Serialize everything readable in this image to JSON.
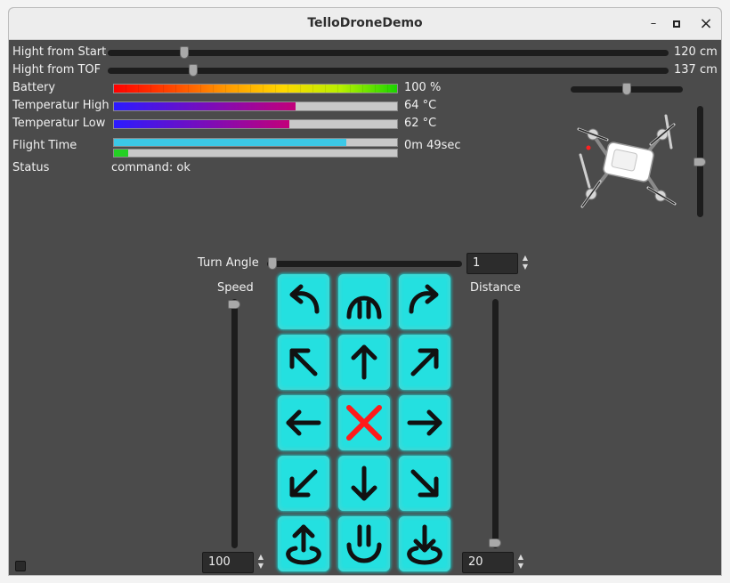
{
  "window": {
    "title": "TelloDroneDemo",
    "minimize": "–",
    "maximize": "▫",
    "close": "×"
  },
  "telemetry": {
    "height_start": {
      "label": "Hight from Start",
      "value": "120 cm",
      "level": 0.13
    },
    "height_tof": {
      "label": "Hight from TOF",
      "value": "137 cm",
      "level": 0.145
    },
    "battery": {
      "label": "Battery",
      "value": "100 %",
      "percent": 100
    },
    "temp_high": {
      "label": "Temperatur High",
      "value": "64 °C",
      "percent": 64
    },
    "temp_low": {
      "label": "Temperatur Low",
      "value": "62 °C",
      "percent": 62
    },
    "flight_time": {
      "label": "Flight Time",
      "value": "0m 49sec",
      "percent": 82,
      "secondary_percent": 5
    },
    "status": {
      "label": "Status",
      "value": "command: ok"
    }
  },
  "view": {
    "horizontal_level": 0.5,
    "vertical_level": 0.5
  },
  "controls": {
    "turn_angle": {
      "label": "Turn Angle",
      "value": "1",
      "level": 0.0
    },
    "speed": {
      "label": "Speed",
      "value": "100",
      "level": 1.0
    },
    "distance": {
      "label": "Distance",
      "value": "20",
      "level": 0.0
    }
  },
  "pad_buttons": [
    "rotate-left",
    "land-pause",
    "rotate-right",
    "forward-left",
    "forward",
    "forward-right",
    "left",
    "stop",
    "right",
    "back-left",
    "back",
    "back-right",
    "takeoff",
    "hover",
    "land"
  ],
  "colors": {
    "pad_button": "#24e0e0",
    "stop_cross": "#ff1a1a",
    "temp_gradient_start": "#2b1bff",
    "temp_gradient_end": "#c2007a",
    "flight_bar": "#3cc8e6",
    "flight_secondary": "#24d024"
  }
}
